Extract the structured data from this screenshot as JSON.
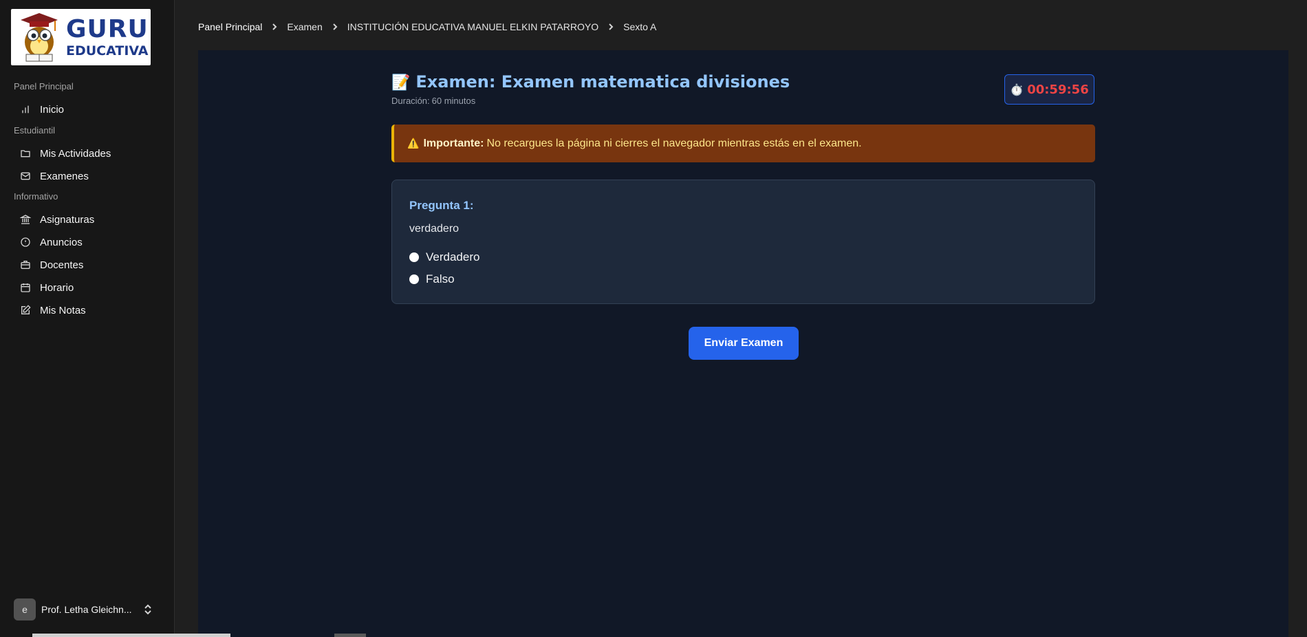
{
  "logo": {
    "line1": "GURU",
    "line2": "EDUCATIVA"
  },
  "sidebar": {
    "sections": [
      {
        "label": "Panel Principal",
        "items": [
          {
            "label": "Inicio",
            "icon": "bar-chart-icon"
          }
        ]
      },
      {
        "label": "Estudiantil",
        "items": [
          {
            "label": "Mis Actividades",
            "icon": "folder-icon"
          },
          {
            "label": "Examenes",
            "icon": "mail-icon"
          }
        ]
      },
      {
        "label": "Informativo",
        "items": [
          {
            "label": "Asignaturas",
            "icon": "landmark-icon"
          },
          {
            "label": "Anuncios",
            "icon": "info-icon"
          },
          {
            "label": "Docentes",
            "icon": "briefcase-icon"
          },
          {
            "label": "Horario",
            "icon": "calendar-icon"
          },
          {
            "label": "Mis Notas",
            "icon": "edit-icon"
          }
        ]
      }
    ],
    "user": {
      "avatar": "e",
      "name": "Prof. Letha Gleichn..."
    }
  },
  "breadcrumb": [
    "Panel Principal",
    "Examen",
    "INSTITUCIÓN EDUCATIVA MANUEL ELKIN PATARROYO",
    "Sexto A"
  ],
  "exam": {
    "title_icon": "📝",
    "title": "Examen: Examen matematica divisiones",
    "duration_label": "Duración:",
    "duration_value": "60 minutos",
    "timer_icon": "⏱️",
    "timer": "00:59:56"
  },
  "alert": {
    "icon": "⚠️",
    "strong": "Importante:",
    "text": "No recargues la página ni cierres el navegador mientras estás en el examen."
  },
  "question": {
    "title": "Pregunta 1:",
    "text": "verdadero",
    "options": [
      "Verdadero",
      "Falso"
    ]
  },
  "submit_label": "Enviar Examen",
  "colors": {
    "accent": "#2563eb",
    "title": "#93c5fd",
    "timer": "#ef4444",
    "alert_bg": "#78350f"
  }
}
